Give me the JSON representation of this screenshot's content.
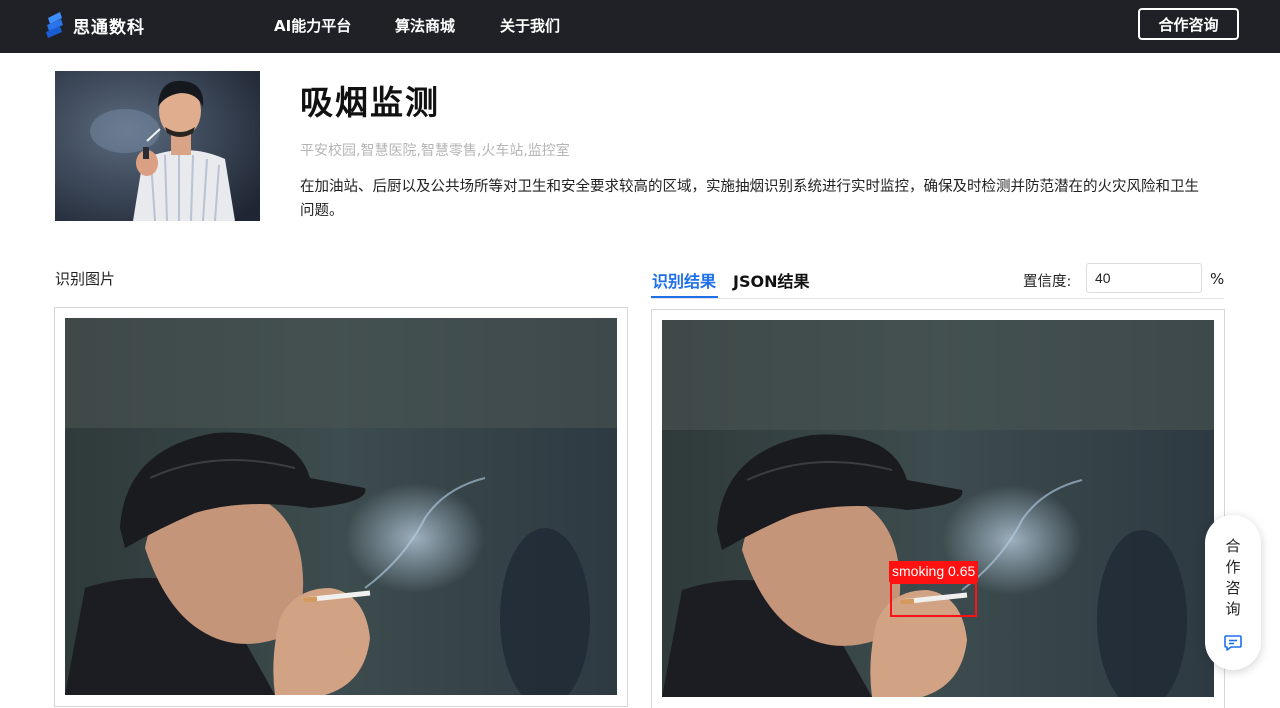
{
  "brand": {
    "name": "思通数科"
  },
  "nav": {
    "items": [
      {
        "label": "AI能力平台"
      },
      {
        "label": "算法商城"
      },
      {
        "label": "关于我们"
      }
    ],
    "contact_label": "合作咨询"
  },
  "product": {
    "title": "吸烟监测",
    "tags": "平安校园,智慧医院,智慧零售,火车站,监控室",
    "description": "在加油站、后厨以及公共场所等对卫生和安全要求较高的区域，实施抽烟识别系统进行实时监控，确保及时检测并防范潜在的火灾风险和卫生问题。"
  },
  "left_panel": {
    "label": "识别图片"
  },
  "right_panel": {
    "tabs": [
      {
        "label": "识别结果",
        "active": true
      },
      {
        "label": "JSON结果",
        "active": false
      }
    ],
    "confidence_label": "置信度:",
    "confidence_value": "40",
    "confidence_unit": "%",
    "detection": {
      "label": "smoking 0.65",
      "class": "smoking",
      "score": 0.65
    }
  },
  "float_button": {
    "chars": [
      "合",
      "作",
      "咨",
      "询"
    ],
    "icon": "chat-icon"
  },
  "colors": {
    "nav_bg": "#1f2126",
    "accent": "#1e6fe8",
    "detection": "#ff1111"
  }
}
